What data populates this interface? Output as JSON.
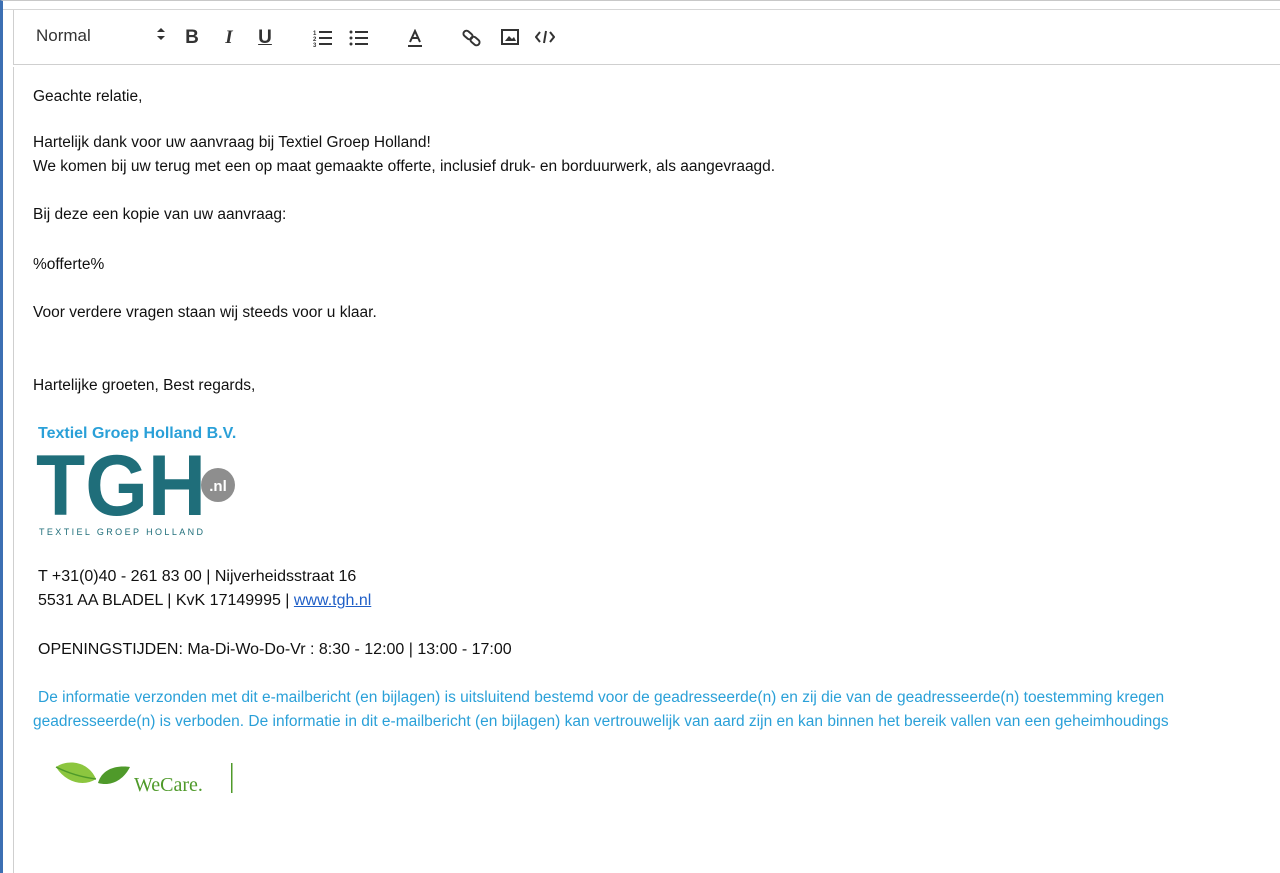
{
  "toolbar": {
    "heading_select": {
      "value": "Normal"
    },
    "buttons": [
      {
        "name": "bold-button",
        "label": "B"
      },
      {
        "name": "italic-button",
        "label": "I"
      },
      {
        "name": "underline-button",
        "label": "U"
      }
    ],
    "icons": [
      "ordered-list-icon",
      "bullet-list-icon",
      "text-color-icon",
      "link-icon",
      "image-icon",
      "code-icon"
    ]
  },
  "body": {
    "greeting": "Geachte relatie,",
    "line1": "Hartelijk dank voor uw aanvraag bij Textiel Groep Holland!",
    "line2": "We komen bij uw terug met een op maat gemaakte offerte, inclusief druk- en borduurwerk, als aangevraagd.",
    "line3": "Bij deze een kopie van uw aanvraag:",
    "placeholder": "%offerte%",
    "line4": "Voor verdere vragen staan wij steeds voor u klaar.",
    "closing": "Hartelijke groeten, Best regards,"
  },
  "signature": {
    "company": "Textiel Groep Holland B.V.",
    "logo_text": "TGH",
    "logo_badge": ".nl",
    "logo_sub": "TEXTIEL GROEP HOLLAND",
    "contact1": "T +31(0)40 - 261 83 00 | Nijverheidsstraat 16",
    "contact2_prefix": "5531 AA BLADEL | KvK 17149995 | ",
    "website": "www.tgh.nl",
    "hours": "OPENINGSTIJDEN: Ma-Di-Wo-Do-Vr : 8:30 - 12:00 | 13:00 - 17:00",
    "disclaimer1": "De informatie verzonden met dit e-mailbericht (en bijlagen) is uitsluitend bestemd voor de geadresseerde(n) en zij die van de geadresseerde(n) toestemming kregen",
    "disclaimer2": "geadresseerde(n) is verboden. De informatie in dit e-mailbericht (en bijlagen) kan vertrouwelijk van aard zijn en kan binnen het bereik vallen van een geheimhoudings",
    "wecare_text": "WeCare."
  },
  "colors": {
    "brand_teal": "#1f6e7a",
    "badge_gray": "#8e8e8e",
    "disclaimer_blue": "#2aa0d8",
    "link_blue": "#1f5fc7",
    "leaf_green": "#4f9a2a"
  }
}
